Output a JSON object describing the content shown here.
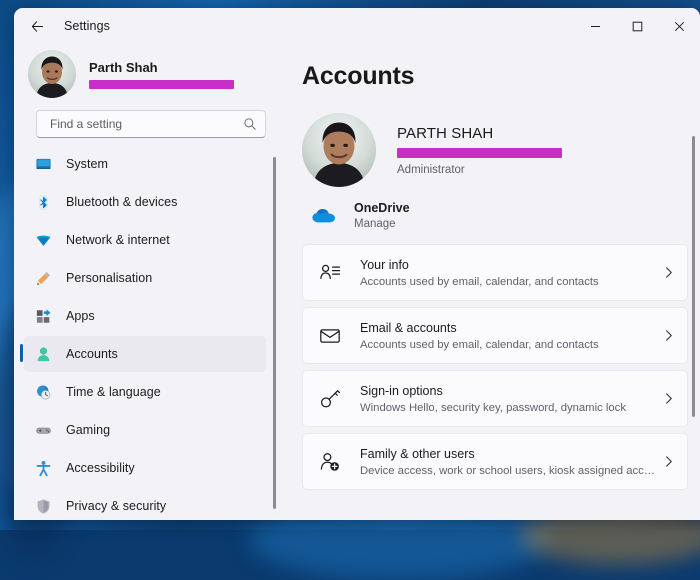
{
  "window": {
    "title": "Settings",
    "back_icon": "arrow-left-icon",
    "controls": {
      "minimize": "–",
      "maximize": "☐",
      "close": "✕"
    }
  },
  "sidebar": {
    "profile": {
      "name": "Parth Shah",
      "email_redacted": true,
      "avatar": "user-avatar"
    },
    "search": {
      "placeholder": "Find a setting",
      "value": "",
      "icon": "search-icon"
    },
    "items": [
      {
        "label": "System",
        "icon": "system-icon",
        "active": false
      },
      {
        "label": "Bluetooth & devices",
        "icon": "bluetooth-icon",
        "active": false
      },
      {
        "label": "Network & internet",
        "icon": "network-icon",
        "active": false
      },
      {
        "label": "Personalisation",
        "icon": "personalisation-icon",
        "active": false
      },
      {
        "label": "Apps",
        "icon": "apps-icon",
        "active": false
      },
      {
        "label": "Accounts",
        "icon": "accounts-icon",
        "active": true
      },
      {
        "label": "Time & language",
        "icon": "time-language-icon",
        "active": false
      },
      {
        "label": "Gaming",
        "icon": "gaming-icon",
        "active": false
      },
      {
        "label": "Accessibility",
        "icon": "accessibility-icon",
        "active": false
      },
      {
        "label": "Privacy & security",
        "icon": "privacy-shield-icon",
        "active": false
      }
    ]
  },
  "main": {
    "page_title": "Accounts",
    "account": {
      "name": "PARTH SHAH",
      "email_redacted": true,
      "role": "Administrator",
      "avatar": "user-avatar"
    },
    "onedrive": {
      "title": "OneDrive",
      "link": "Manage",
      "icon": "onedrive-cloud-icon"
    },
    "cards": [
      {
        "title": "Your info",
        "subtitle": "Accounts used by email, calendar, and contacts",
        "icon": "your-info-icon",
        "chevron": "chevron-right-icon"
      },
      {
        "title": "Email & accounts",
        "subtitle": "Accounts used by email, calendar, and contacts",
        "icon": "envelope-icon",
        "chevron": "chevron-right-icon"
      },
      {
        "title": "Sign-in options",
        "subtitle": "Windows Hello, security key, password, dynamic lock",
        "icon": "key-icon",
        "chevron": "chevron-right-icon"
      },
      {
        "title": "Family & other users",
        "subtitle": "Device access, work or school users, kiosk assigned access",
        "icon": "add-user-icon",
        "chevron": "chevron-right-icon"
      }
    ]
  },
  "colors": {
    "accent": "#0f5fa8",
    "window_bg": "#f3f3f7",
    "card_bg": "#fbfbfd",
    "redaction": "#c82ec8",
    "text_primary": "#1b1b1b",
    "text_secondary": "#60606a"
  }
}
